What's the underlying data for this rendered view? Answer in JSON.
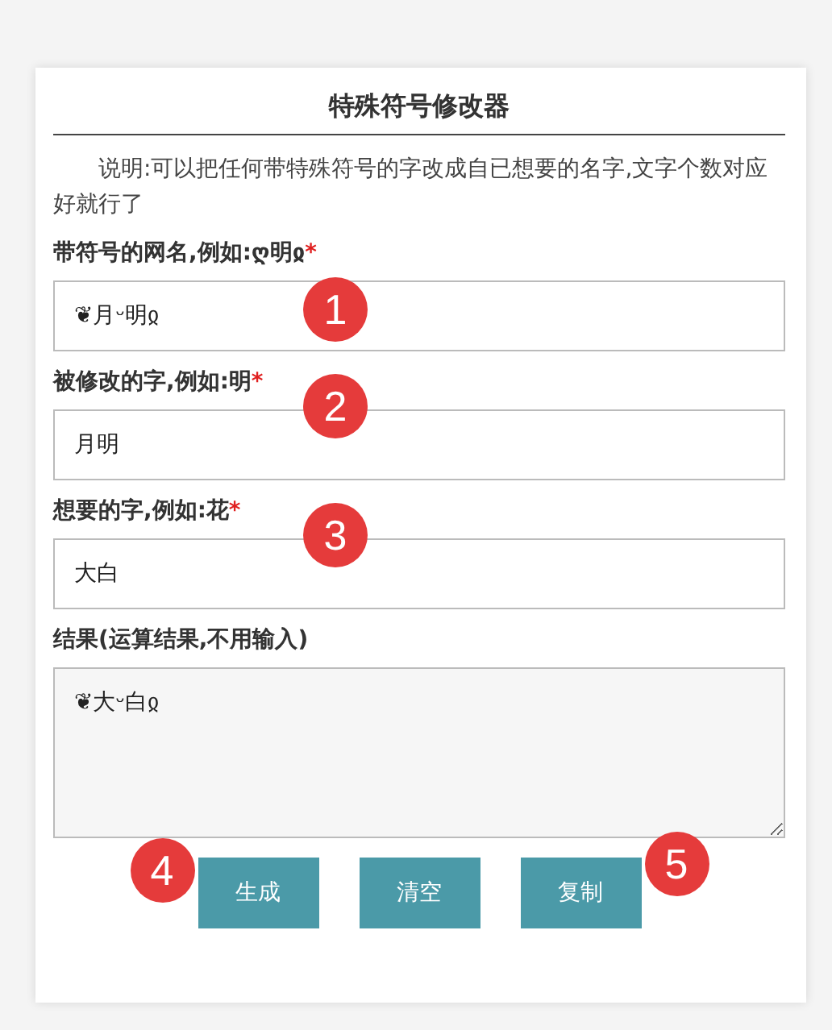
{
  "title": "特殊符号修改器",
  "description": "说明:可以把任何带特殊符号的字改成自已想要的名字,文字个数对应好就行了",
  "fields": [
    {
      "kind": "input",
      "label": "带符号的网名,例如:ღ明ჲ",
      "required": "*",
      "value": "❦月ᵕ明ჲ",
      "marker": "1"
    },
    {
      "kind": "input",
      "label": "被修改的字,例如:明",
      "required": "*",
      "value": "月明",
      "marker": "2"
    },
    {
      "kind": "input",
      "label": "想要的字,例如:花",
      "required": "*",
      "value": "大白",
      "marker": "3"
    },
    {
      "kind": "textarea",
      "label": "结果(运算结果,不用输入)",
      "value": "❦大ᵕ白ჲ"
    }
  ],
  "buttons": [
    {
      "label": "生成",
      "marker": "4"
    },
    {
      "label": "清空"
    },
    {
      "label": "复制",
      "marker": "5"
    }
  ]
}
